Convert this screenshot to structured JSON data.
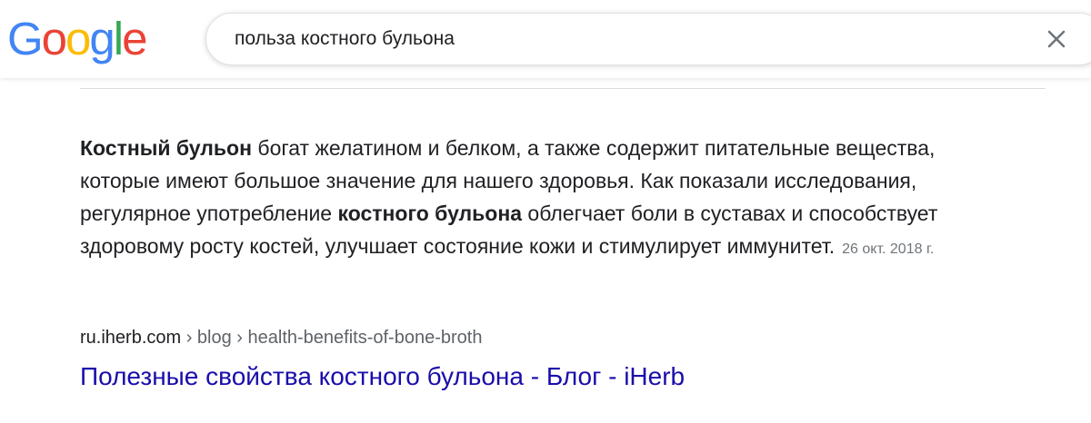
{
  "logo": {
    "letters": [
      {
        "char": "G",
        "color": "#4285F4"
      },
      {
        "char": "o",
        "color": "#EA4335"
      },
      {
        "char": "o",
        "color": "#FBBC05"
      },
      {
        "char": "g",
        "color": "#4285F4"
      },
      {
        "char": "l",
        "color": "#34A853"
      },
      {
        "char": "e",
        "color": "#EA4335"
      }
    ]
  },
  "search": {
    "query": "польза костного бульона",
    "clear_icon": "close-icon"
  },
  "snippet": {
    "bold_1": "Костный бульон",
    "text_1": " богат желатином и белком, а также содержит питательные вещества, которые имеют большое значение для нашего здоровья. Как показали исследования, регулярное употребление ",
    "bold_2": "костного бульона",
    "text_2": " облегчает боли в суставах и способствует здоровому росту костей, улучшает состояние кожи и стимулирует иммунитет.",
    "date": "26 окт. 2018 г."
  },
  "result": {
    "domain": "ru.iherb.com",
    "path": " › blog › health-benefits-of-bone-broth",
    "title": "Полезные свойства костного бульона - Блог - iHerb"
  },
  "colors": {
    "link": "#1a0dab",
    "text": "#202124",
    "muted": "#70757a"
  }
}
